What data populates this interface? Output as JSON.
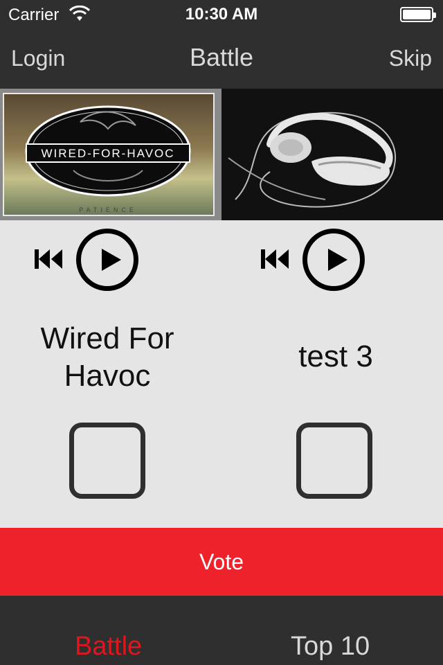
{
  "status": {
    "carrier": "Carrier",
    "time": "10:30 AM",
    "wifi_icon": "wifi-icon",
    "battery_icon": "battery-icon"
  },
  "nav": {
    "left": "Login",
    "title": "Battle",
    "right": "Skip"
  },
  "contenders": [
    {
      "name": "Wired For Havoc",
      "artwork_text": "WIRED-FOR-HAVOC",
      "artwork_subtext": "PATIENCE",
      "rewind_icon": "rewind-icon",
      "play_icon": "play-icon"
    },
    {
      "name": "test 3",
      "artwork_icon": "headphones-image",
      "rewind_icon": "rewind-icon",
      "play_icon": "play-icon"
    }
  ],
  "vote": {
    "label": "Vote"
  },
  "tabs": [
    {
      "label": "Battle",
      "active": true
    },
    {
      "label": "Top 10",
      "active": false
    }
  ],
  "colors": {
    "bar": "#2f2f2f",
    "accent": "#ee222b",
    "active_tab": "#e0161f",
    "background": "#e5e5e5"
  }
}
